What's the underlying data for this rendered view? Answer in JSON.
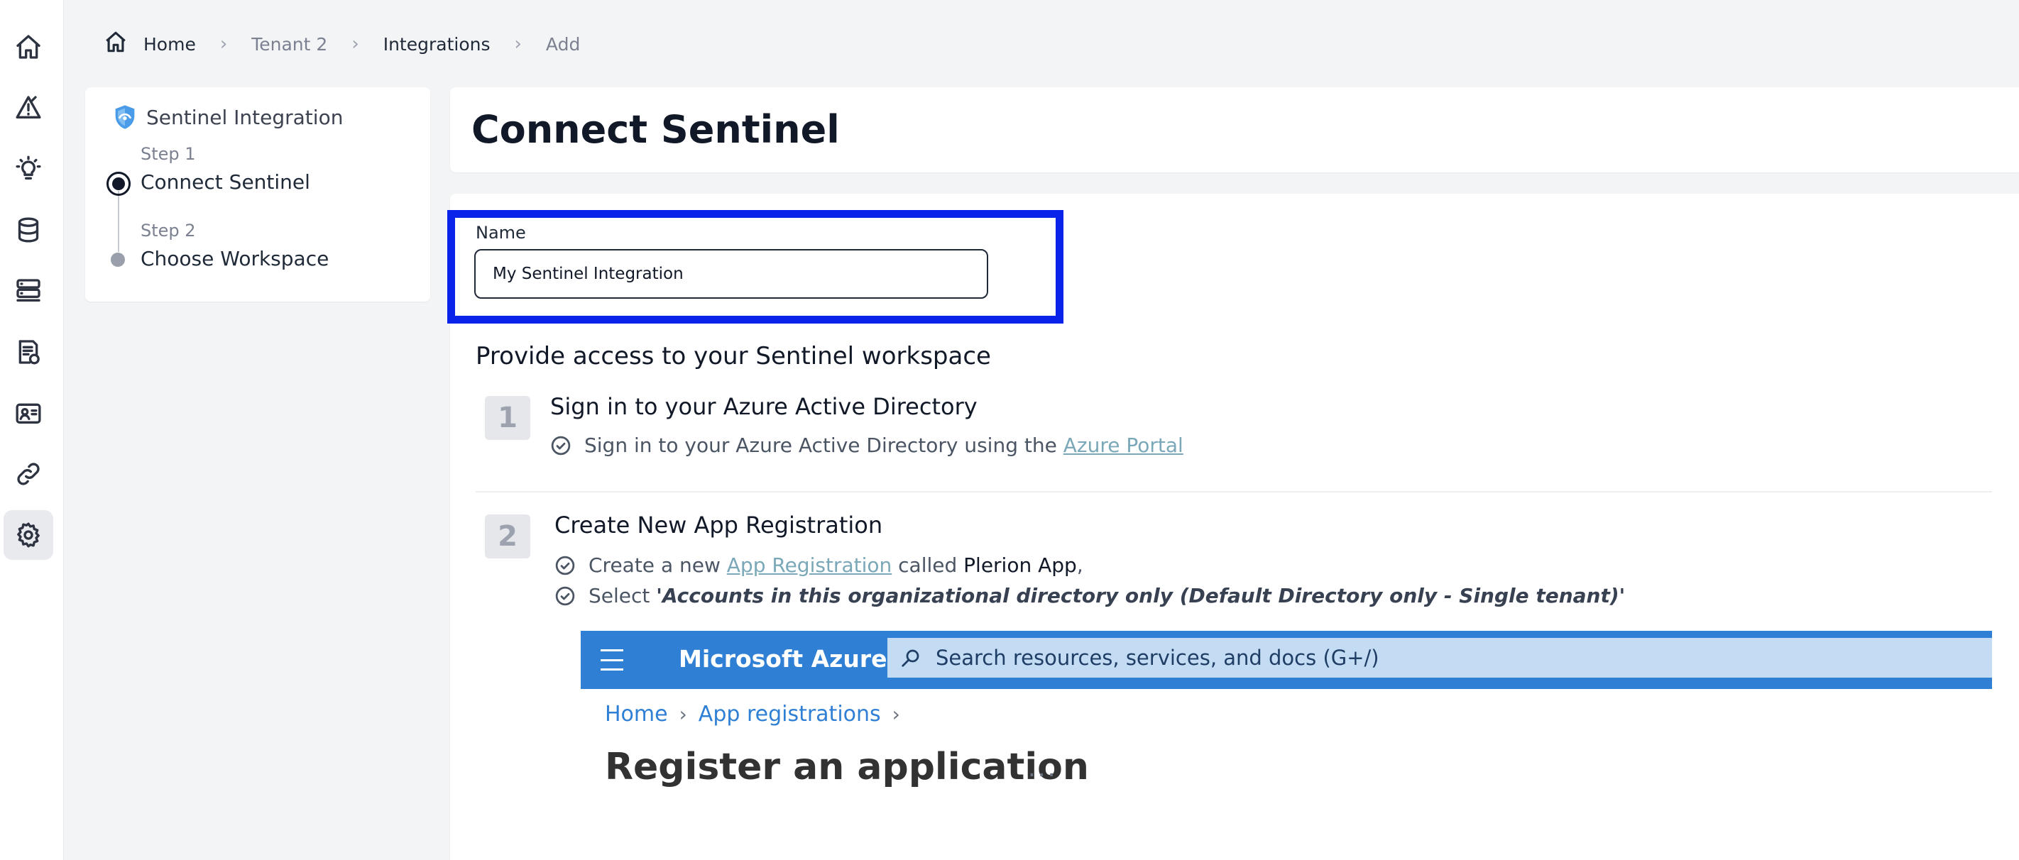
{
  "rail": {
    "items": [
      {
        "icon": "home-icon"
      },
      {
        "icon": "alert-icon"
      },
      {
        "icon": "lightbulb-icon"
      },
      {
        "icon": "database-icon"
      },
      {
        "icon": "server-icon"
      },
      {
        "icon": "compliance-report-icon"
      },
      {
        "icon": "identity-card-icon"
      },
      {
        "icon": "integrations-link-icon"
      },
      {
        "icon": "gear-icon",
        "active": true
      }
    ]
  },
  "breadcrumb": {
    "home": "Home",
    "tenant": "Tenant 2",
    "integrations": "Integrations",
    "current": "Add"
  },
  "stepper": {
    "title": "Sentinel Integration",
    "steps": [
      {
        "label": "Step 1",
        "name": "Connect Sentinel",
        "state": "active"
      },
      {
        "label": "Step 2",
        "name": "Choose Workspace",
        "state": "pending"
      }
    ]
  },
  "page": {
    "title": "Connect Sentinel"
  },
  "form": {
    "name_label": "Name",
    "name_value": "My Sentinel Integration"
  },
  "instructions": {
    "section_title": "Provide access to your Sentinel workspace",
    "steps": [
      {
        "number": "1",
        "heading": "Sign in to your Azure Active Directory",
        "items": [
          {
            "text": "Sign in to your Azure Active Directory using the ",
            "link": "Azure Portal"
          }
        ]
      },
      {
        "number": "2",
        "heading": "Create New App Registration",
        "items": [
          {
            "prefix": "Create a new ",
            "link": "App Registration",
            "middle": " called ",
            "strong": "Plerion App",
            "suffix": ","
          },
          {
            "prefix": "Select ",
            "emphasis": "'Accounts in this organizational directory only (Default Directory only - Single tenant)'"
          }
        ]
      }
    ]
  },
  "azure_screenshot": {
    "brand": "Microsoft Azure",
    "search_placeholder": "Search resources, services, and docs (G+/)",
    "breadcrumb_home": "Home",
    "breadcrumb_app_registrations": "App registrations",
    "title": "Register an application",
    "more": "..."
  },
  "colors": {
    "highlight_border": "#0a23e8",
    "azure_bar": "#2f7fd4",
    "azure_search": "#c3dbf3",
    "link": "#7aa8b8"
  }
}
